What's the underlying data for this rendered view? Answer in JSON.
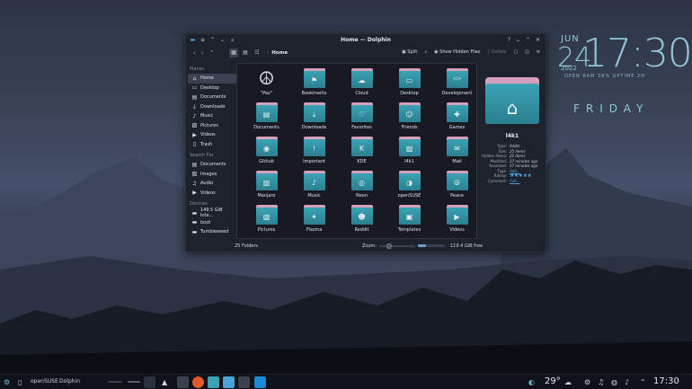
{
  "desktop": {
    "clock_widget": {
      "month": "JUN",
      "day": "24",
      "year": "2022",
      "time": "17:30",
      "subtitle": "OPEN RAM 36% UPTIME 2H",
      "weekday": "FRIDAY"
    }
  },
  "window": {
    "title": "Home — Dolphin",
    "titlebar_buttons": [
      "?",
      "⌄",
      "⌃",
      "✕"
    ],
    "breadcrumb": "Home",
    "toolbar": {
      "split_label": "Split",
      "show_hidden_label": "Show Hidden Files",
      "delete_label": "Delete"
    },
    "sidebar": {
      "places_heading": "Places",
      "places": [
        {
          "label": "Home",
          "icon": "home-icon",
          "active": true
        },
        {
          "label": "Desktop",
          "icon": "desktop-icon"
        },
        {
          "label": "Documents",
          "icon": "documents-icon"
        },
        {
          "label": "Downloads",
          "icon": "downloads-icon"
        },
        {
          "label": "Music",
          "icon": "music-icon"
        },
        {
          "label": "Pictures",
          "icon": "pictures-icon"
        },
        {
          "label": "Videos",
          "icon": "videos-icon"
        },
        {
          "label": "Trash",
          "icon": "trash-icon"
        }
      ],
      "search_heading": "Search For",
      "search": [
        {
          "label": "Documents",
          "icon": "documents-icon"
        },
        {
          "label": "Images",
          "icon": "images-icon"
        },
        {
          "label": "Audio",
          "icon": "audio-icon"
        },
        {
          "label": "Videos",
          "icon": "videos-icon"
        }
      ],
      "devices_heading": "Devices",
      "devices": [
        {
          "label": "149.5 GiB Inte...",
          "icon": "drive-icon"
        },
        {
          "label": "boot",
          "icon": "drive-icon"
        },
        {
          "label": "Tumbleweed",
          "icon": "drive-icon"
        }
      ]
    },
    "folders": [
      {
        "label": "\"Pax\"",
        "icon": "peace-icon"
      },
      {
        "label": "Bookmarks",
        "icon": "bookmark-icon"
      },
      {
        "label": "Cloud",
        "icon": "cloud-icon"
      },
      {
        "label": "Desktop",
        "icon": "desktop-icon"
      },
      {
        "label": "Development",
        "icon": "code-icon"
      },
      {
        "label": "Documents",
        "icon": "document-icon"
      },
      {
        "label": "Downloads",
        "icon": "download-icon"
      },
      {
        "label": "Favorites",
        "icon": "heart-icon"
      },
      {
        "label": "Friends",
        "icon": "people-icon"
      },
      {
        "label": "Games",
        "icon": "gamepad-icon"
      },
      {
        "label": "Github",
        "icon": "github-icon"
      },
      {
        "label": "Important",
        "icon": "important-icon"
      },
      {
        "label": "KDE",
        "icon": "kde-icon"
      },
      {
        "label": "l4k1",
        "icon": "image-icon"
      },
      {
        "label": "Mail",
        "icon": "mail-icon"
      },
      {
        "label": "Manjaro",
        "icon": "manjaro-icon"
      },
      {
        "label": "Music",
        "icon": "music-icon"
      },
      {
        "label": "Neon",
        "icon": "neon-icon"
      },
      {
        "label": "openSUSE",
        "icon": "opensuse-icon"
      },
      {
        "label": "Peace",
        "icon": "peace-icon"
      },
      {
        "label": "Pictures",
        "icon": "pictures-icon"
      },
      {
        "label": "Plasma",
        "icon": "plasma-icon"
      },
      {
        "label": "Reddit",
        "icon": "reddit-icon"
      },
      {
        "label": "Templates",
        "icon": "template-icon"
      },
      {
        "label": "Videos",
        "icon": "video-icon"
      }
    ],
    "info_panel": {
      "name": "l4k1",
      "properties": [
        {
          "key": "Type:",
          "value": "folder"
        },
        {
          "key": "Size:",
          "value": "25 items"
        },
        {
          "key": "Hidden Items:",
          "value": "22 items"
        },
        {
          "key": "Modified:",
          "value": "37 minutes ago"
        },
        {
          "key": "Accessed:",
          "value": "37 minutes ago"
        },
        {
          "key": "Tags:",
          "value": "Add...",
          "link": true
        },
        {
          "key": "Rating:",
          "value": "★★★★★",
          "stars": true
        },
        {
          "key": "Comment:",
          "value": "Add...",
          "link": true
        }
      ]
    },
    "statusbar": {
      "count": "25 Folders",
      "zoom_label": "Zoom:",
      "disk_used_fraction": 0.3,
      "free_space": "119.4 GiB free"
    }
  },
  "taskbar": {
    "items": [
      {
        "label": "openSUSE"
      },
      {
        "label": "Dolphin"
      }
    ],
    "temperature": "29°",
    "time": "17:30"
  },
  "colors": {
    "accent": "#4aa3d8",
    "folder_teal": "#3aa3b4",
    "folder_pink": "#d6a0bd",
    "window_bg": "#1e222c"
  }
}
